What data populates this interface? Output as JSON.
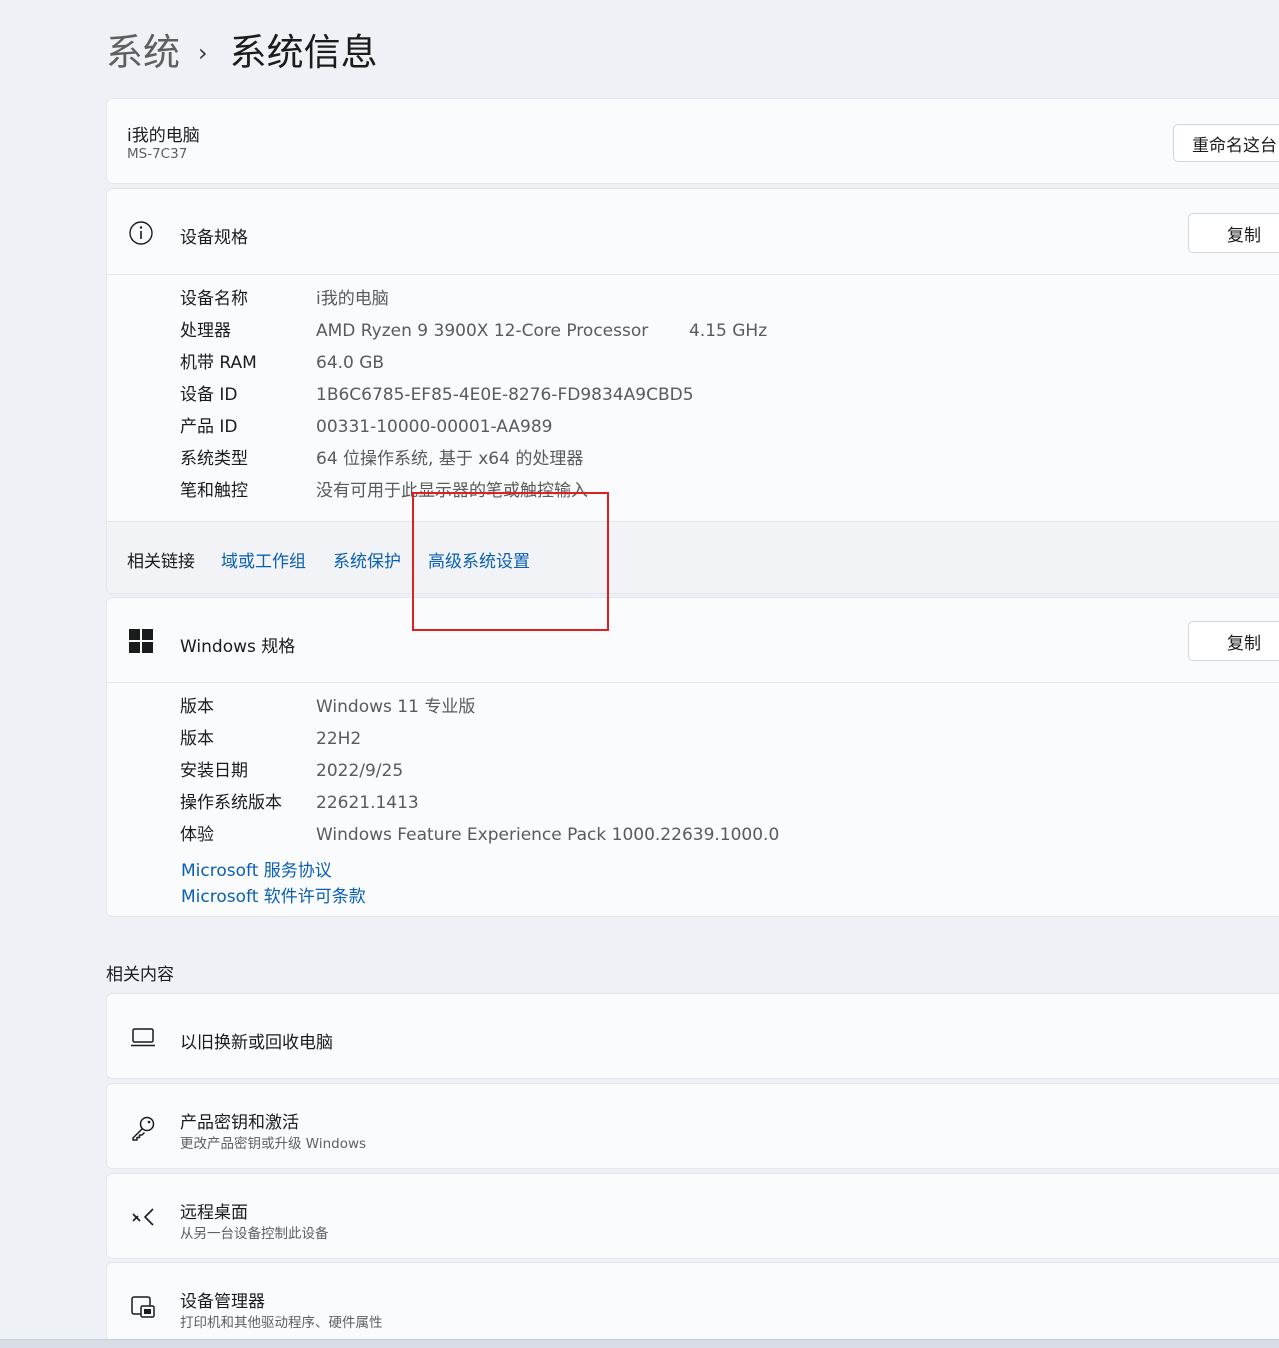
{
  "breadcrumb": {
    "parent": "系统",
    "separator": "›",
    "current": "系统信息"
  },
  "pc": {
    "name": "i我的电脑",
    "model": "MS-7C37",
    "rename_button": "重命名这台电脑"
  },
  "device_specs": {
    "title": "设备规格",
    "copy_button": "复制",
    "rows": [
      {
        "key": "设备名称",
        "value": "i我的电脑"
      },
      {
        "key": "处理器",
        "value": "AMD Ryzen 9 3900X 12-Core Processor",
        "extra": "4.15 GHz"
      },
      {
        "key": "机带 RAM",
        "value": "64.0 GB"
      },
      {
        "key": "设备 ID",
        "value": "1B6C6785-EF85-4E0E-8276-FD9834A9CBD5"
      },
      {
        "key": "产品 ID",
        "value": "00331-10000-00001-AA989"
      },
      {
        "key": "系统类型",
        "value": "64 位操作系统, 基于 x64 的处理器"
      },
      {
        "key": "笔和触控",
        "value": "没有可用于此显示器的笔或触控输入"
      }
    ]
  },
  "related_links": {
    "label": "相关链接",
    "links": [
      "域或工作组",
      "系统保护",
      "高级系统设置"
    ]
  },
  "windows_specs": {
    "title": "Windows 规格",
    "copy_button": "复制",
    "rows": [
      {
        "key": "版本",
        "value": "Windows 11 专业版"
      },
      {
        "key": "版本",
        "value": "22H2"
      },
      {
        "key": "安装日期",
        "value": "2022/9/25"
      },
      {
        "key": "操作系统版本",
        "value": "22621.1413"
      },
      {
        "key": "体验",
        "value": "Windows Feature Experience Pack 1000.22639.1000.0"
      }
    ],
    "links": [
      "Microsoft 服务协议",
      "Microsoft 软件许可条款"
    ]
  },
  "related_content": {
    "title": "相关内容",
    "items": [
      {
        "title": "以旧换新或回收电脑",
        "subtitle": "",
        "icon": "laptop-icon"
      },
      {
        "title": "产品密钥和激活",
        "subtitle": "更改产品密钥或升级 Windows",
        "icon": "key-icon"
      },
      {
        "title": "远程桌面",
        "subtitle": "从另一台设备控制此设备",
        "icon": "remote-desktop-icon"
      },
      {
        "title": "设备管理器",
        "subtitle": "打印机和其他驱动程序、硬件属性",
        "icon": "device-manager-icon"
      }
    ]
  },
  "colors": {
    "link": "#0a5fb4",
    "highlight_box": "#e02020",
    "background": "#eef2f7",
    "card": "#fafbfd"
  }
}
